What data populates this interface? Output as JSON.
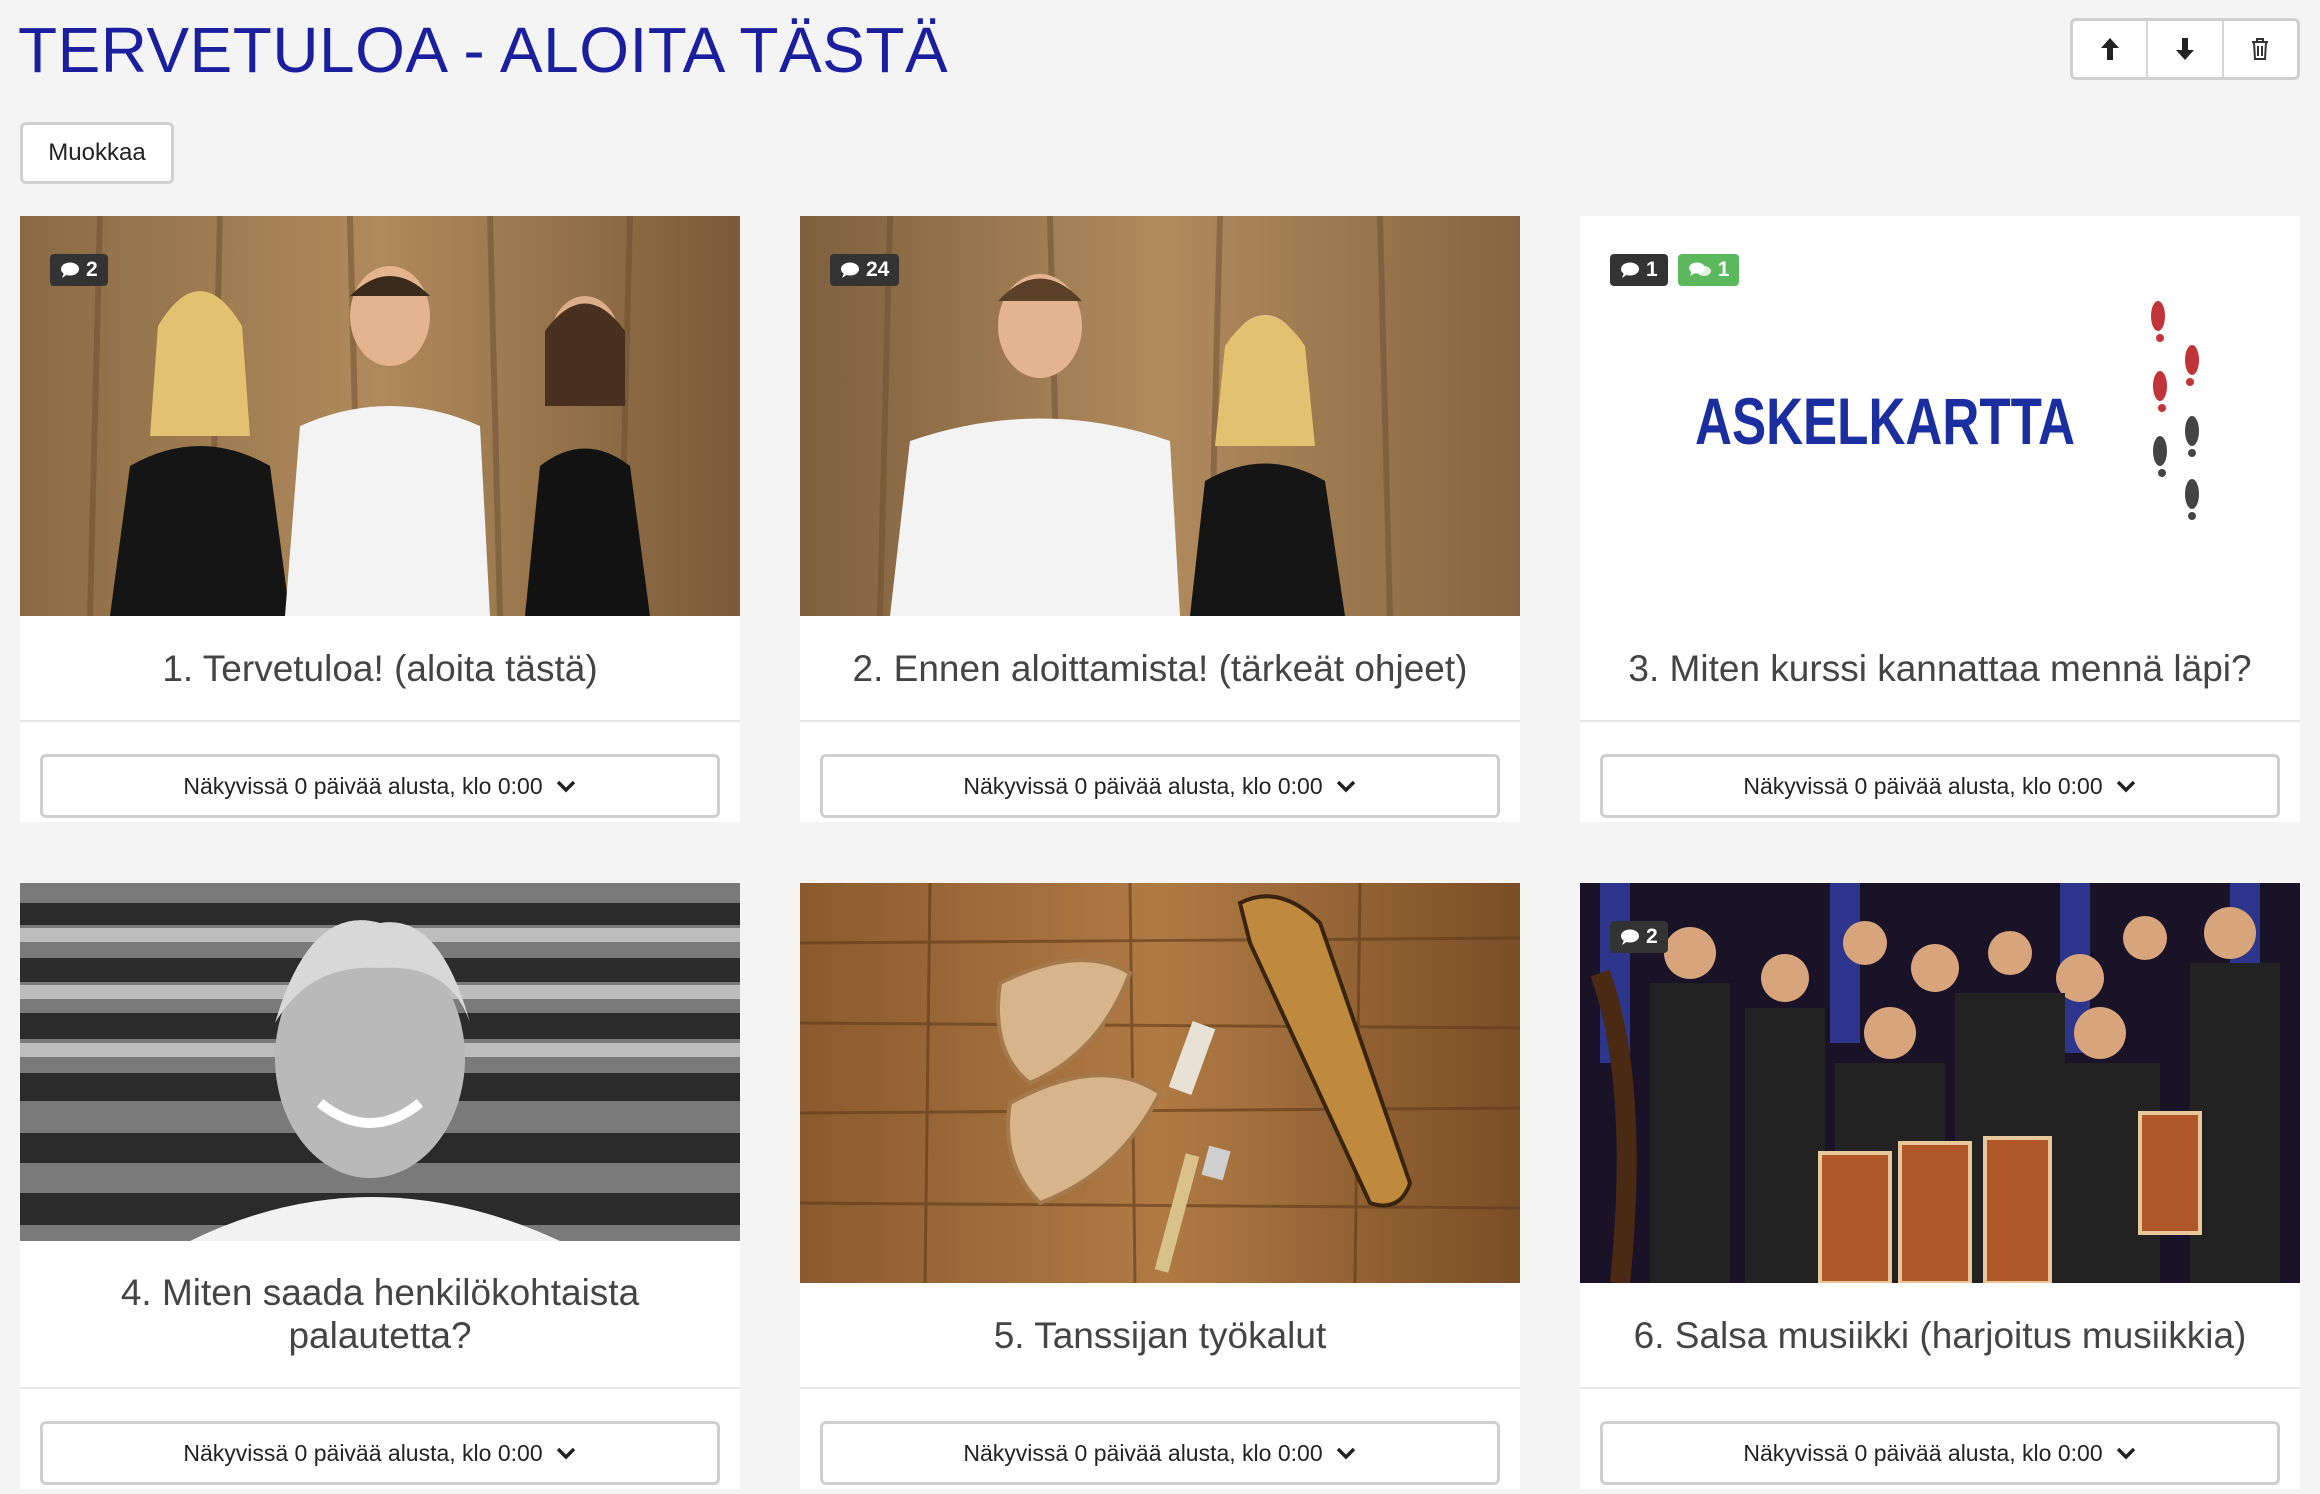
{
  "header": {
    "title": "TERVETULOA - ALOITA TÄSTÄ"
  },
  "toolbar": {
    "up_icon": "arrow-up-icon",
    "down_icon": "arrow-down-icon",
    "delete_icon": "trash-icon"
  },
  "edit_button": {
    "label": "Muokkaa"
  },
  "cards": [
    {
      "title": "1. Tervetuloa! (aloita tästä)",
      "comments": "2",
      "new_comments": "",
      "visibility": "Näkyvissä 0 päivää alusta, klo 0:00"
    },
    {
      "title": "2. Ennen aloittamista! (tärkeät ohjeet)",
      "comments": "24",
      "new_comments": "",
      "visibility": "Näkyvissä 0 päivää alusta, klo 0:00"
    },
    {
      "title": "3. Miten kurssi kannattaa mennä läpi?",
      "comments": "1",
      "new_comments": "1",
      "visibility": "Näkyvissä 0 päivää alusta, klo 0:00",
      "image_text": "ASKELKARTTA"
    },
    {
      "title": "4. Miten saada henkilökohtaista palautetta?",
      "comments": "",
      "new_comments": "",
      "visibility": "Näkyvissä 0 päivää alusta, klo 0:00"
    },
    {
      "title": "5. Tanssijan työkalut",
      "comments": "",
      "new_comments": "",
      "visibility": "Näkyvissä 0 päivää alusta, klo 0:00"
    },
    {
      "title": "6. Salsa musiikki (harjoitus musiikkia)",
      "comments": "2",
      "new_comments": "",
      "visibility": "Näkyvissä 0 päivää alusta, klo 0:00"
    }
  ],
  "colors": {
    "title": "#1b1f9e",
    "badge": "#333333",
    "badge_new": "#5cb85c",
    "background": "#f4f4f4"
  }
}
